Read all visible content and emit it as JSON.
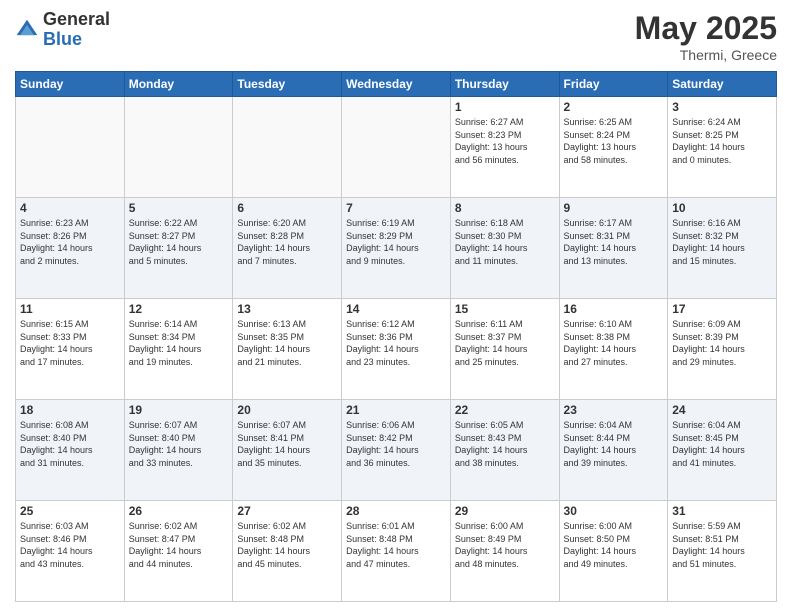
{
  "logo": {
    "general": "General",
    "blue": "Blue"
  },
  "title": {
    "month_year": "May 2025",
    "location": "Thermi, Greece"
  },
  "days_of_week": [
    "Sunday",
    "Monday",
    "Tuesday",
    "Wednesday",
    "Thursday",
    "Friday",
    "Saturday"
  ],
  "weeks": [
    [
      {
        "day": "",
        "info": ""
      },
      {
        "day": "",
        "info": ""
      },
      {
        "day": "",
        "info": ""
      },
      {
        "day": "",
        "info": ""
      },
      {
        "day": "1",
        "info": "Sunrise: 6:27 AM\nSunset: 8:23 PM\nDaylight: 13 hours\nand 56 minutes."
      },
      {
        "day": "2",
        "info": "Sunrise: 6:25 AM\nSunset: 8:24 PM\nDaylight: 13 hours\nand 58 minutes."
      },
      {
        "day": "3",
        "info": "Sunrise: 6:24 AM\nSunset: 8:25 PM\nDaylight: 14 hours\nand 0 minutes."
      }
    ],
    [
      {
        "day": "4",
        "info": "Sunrise: 6:23 AM\nSunset: 8:26 PM\nDaylight: 14 hours\nand 2 minutes."
      },
      {
        "day": "5",
        "info": "Sunrise: 6:22 AM\nSunset: 8:27 PM\nDaylight: 14 hours\nand 5 minutes."
      },
      {
        "day": "6",
        "info": "Sunrise: 6:20 AM\nSunset: 8:28 PM\nDaylight: 14 hours\nand 7 minutes."
      },
      {
        "day": "7",
        "info": "Sunrise: 6:19 AM\nSunset: 8:29 PM\nDaylight: 14 hours\nand 9 minutes."
      },
      {
        "day": "8",
        "info": "Sunrise: 6:18 AM\nSunset: 8:30 PM\nDaylight: 14 hours\nand 11 minutes."
      },
      {
        "day": "9",
        "info": "Sunrise: 6:17 AM\nSunset: 8:31 PM\nDaylight: 14 hours\nand 13 minutes."
      },
      {
        "day": "10",
        "info": "Sunrise: 6:16 AM\nSunset: 8:32 PM\nDaylight: 14 hours\nand 15 minutes."
      }
    ],
    [
      {
        "day": "11",
        "info": "Sunrise: 6:15 AM\nSunset: 8:33 PM\nDaylight: 14 hours\nand 17 minutes."
      },
      {
        "day": "12",
        "info": "Sunrise: 6:14 AM\nSunset: 8:34 PM\nDaylight: 14 hours\nand 19 minutes."
      },
      {
        "day": "13",
        "info": "Sunrise: 6:13 AM\nSunset: 8:35 PM\nDaylight: 14 hours\nand 21 minutes."
      },
      {
        "day": "14",
        "info": "Sunrise: 6:12 AM\nSunset: 8:36 PM\nDaylight: 14 hours\nand 23 minutes."
      },
      {
        "day": "15",
        "info": "Sunrise: 6:11 AM\nSunset: 8:37 PM\nDaylight: 14 hours\nand 25 minutes."
      },
      {
        "day": "16",
        "info": "Sunrise: 6:10 AM\nSunset: 8:38 PM\nDaylight: 14 hours\nand 27 minutes."
      },
      {
        "day": "17",
        "info": "Sunrise: 6:09 AM\nSunset: 8:39 PM\nDaylight: 14 hours\nand 29 minutes."
      }
    ],
    [
      {
        "day": "18",
        "info": "Sunrise: 6:08 AM\nSunset: 8:40 PM\nDaylight: 14 hours\nand 31 minutes."
      },
      {
        "day": "19",
        "info": "Sunrise: 6:07 AM\nSunset: 8:40 PM\nDaylight: 14 hours\nand 33 minutes."
      },
      {
        "day": "20",
        "info": "Sunrise: 6:07 AM\nSunset: 8:41 PM\nDaylight: 14 hours\nand 35 minutes."
      },
      {
        "day": "21",
        "info": "Sunrise: 6:06 AM\nSunset: 8:42 PM\nDaylight: 14 hours\nand 36 minutes."
      },
      {
        "day": "22",
        "info": "Sunrise: 6:05 AM\nSunset: 8:43 PM\nDaylight: 14 hours\nand 38 minutes."
      },
      {
        "day": "23",
        "info": "Sunrise: 6:04 AM\nSunset: 8:44 PM\nDaylight: 14 hours\nand 39 minutes."
      },
      {
        "day": "24",
        "info": "Sunrise: 6:04 AM\nSunset: 8:45 PM\nDaylight: 14 hours\nand 41 minutes."
      }
    ],
    [
      {
        "day": "25",
        "info": "Sunrise: 6:03 AM\nSunset: 8:46 PM\nDaylight: 14 hours\nand 43 minutes."
      },
      {
        "day": "26",
        "info": "Sunrise: 6:02 AM\nSunset: 8:47 PM\nDaylight: 14 hours\nand 44 minutes."
      },
      {
        "day": "27",
        "info": "Sunrise: 6:02 AM\nSunset: 8:48 PM\nDaylight: 14 hours\nand 45 minutes."
      },
      {
        "day": "28",
        "info": "Sunrise: 6:01 AM\nSunset: 8:48 PM\nDaylight: 14 hours\nand 47 minutes."
      },
      {
        "day": "29",
        "info": "Sunrise: 6:00 AM\nSunset: 8:49 PM\nDaylight: 14 hours\nand 48 minutes."
      },
      {
        "day": "30",
        "info": "Sunrise: 6:00 AM\nSunset: 8:50 PM\nDaylight: 14 hours\nand 49 minutes."
      },
      {
        "day": "31",
        "info": "Sunrise: 5:59 AM\nSunset: 8:51 PM\nDaylight: 14 hours\nand 51 minutes."
      }
    ]
  ]
}
